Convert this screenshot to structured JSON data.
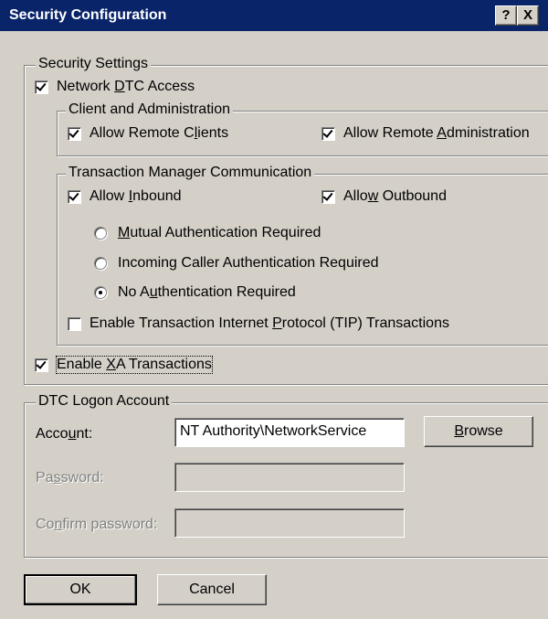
{
  "window": {
    "title": "Security Configuration",
    "help_glyph": "?",
    "close_glyph": "X"
  },
  "security_settings": {
    "legend": "Security Settings",
    "network_dtc_access": {
      "pre": "Network ",
      "acc": "D",
      "post": "TC Access",
      "checked": true
    }
  },
  "client_admin": {
    "legend": "Client and Administration",
    "allow_remote_clients": {
      "pre": "Allow Remote C",
      "acc": "l",
      "post": "ients",
      "checked": true
    },
    "allow_remote_admin": {
      "pre": "Allow Remote ",
      "acc": "A",
      "post": "dministration",
      "checked": true
    }
  },
  "tm_comm": {
    "legend": "Transaction Manager Communication",
    "allow_inbound": {
      "pre": "Allow ",
      "acc": "I",
      "post": "nbound",
      "checked": true
    },
    "allow_outbound": {
      "pre": "Allo",
      "acc": "w",
      "post": " Outbound",
      "checked": true
    },
    "radio_mutual": {
      "pre": "",
      "acc": "M",
      "post": "utual Authentication Required",
      "checked": false
    },
    "radio_incoming": {
      "pre": "Incomin",
      "acc": "g",
      "post": " Caller Authentication Required",
      "checked": false
    },
    "radio_none": {
      "pre": "No A",
      "acc": "u",
      "post": "thentication Required",
      "checked": true
    },
    "tip": {
      "pre": "Enable Transaction Internet ",
      "acc": "P",
      "post": "rotocol (TIP) Transactions",
      "checked": false
    }
  },
  "xa": {
    "pre": "Enable ",
    "acc": "X",
    "post": "A Transactions",
    "checked": true
  },
  "logon": {
    "legend": "DTC Logon Account",
    "account_label": {
      "pre": "Acco",
      "acc": "u",
      "post": "nt:"
    },
    "account_value": "NT Authority\\NetworkService",
    "browse": {
      "pre": "",
      "acc": "B",
      "post": "rowse"
    },
    "password_label": {
      "pre": "Pa",
      "acc": "s",
      "post": "sword:"
    },
    "confirm_label": {
      "pre": "Co",
      "acc": "n",
      "post": "firm password:"
    }
  },
  "buttons": {
    "ok": "OK",
    "cancel": "Cancel"
  }
}
